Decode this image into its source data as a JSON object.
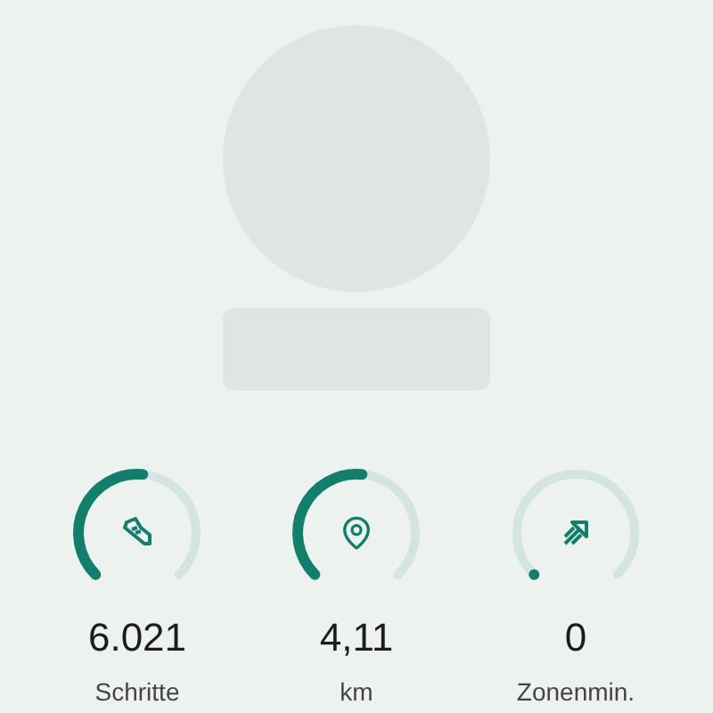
{
  "profile": {
    "kind": "placeholder"
  },
  "metrics": [
    {
      "kind": "steps",
      "value": "6.021",
      "label": "Schritte",
      "started": true
    },
    {
      "kind": "distance",
      "value": "4,11",
      "label": "km",
      "started": true
    },
    {
      "kind": "zone",
      "value": "0",
      "label": "Zonenmin.",
      "started": false
    }
  ]
}
